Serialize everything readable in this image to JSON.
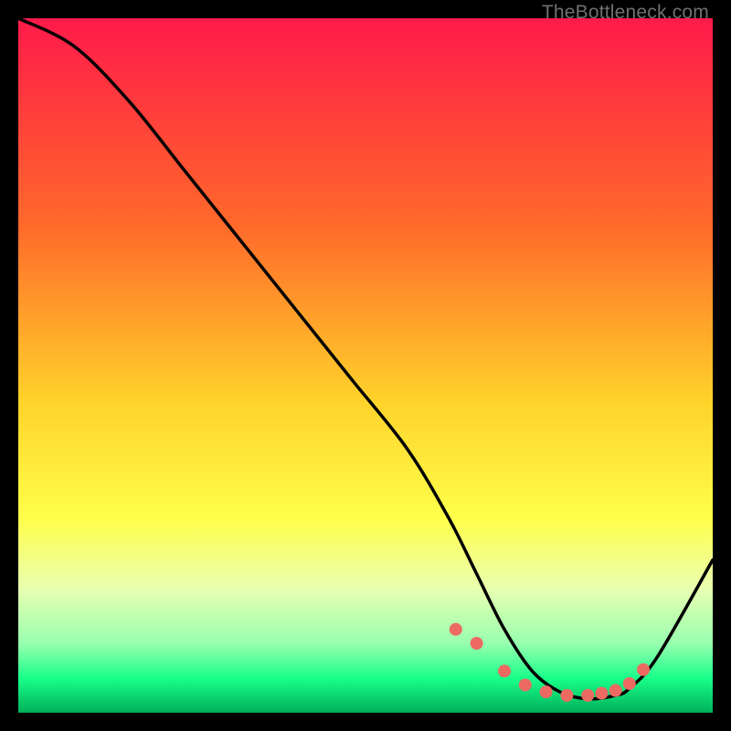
{
  "watermark": "TheBottleneck.com",
  "chart_data": {
    "type": "line",
    "title": "",
    "xlabel": "",
    "ylabel": "",
    "xlim": [
      0,
      100
    ],
    "ylim": [
      0,
      100
    ],
    "gradient_stops": [
      {
        "offset": 0,
        "color": "#ff1a4a"
      },
      {
        "offset": 30,
        "color": "#ff6a2a"
      },
      {
        "offset": 55,
        "color": "#ffd22a"
      },
      {
        "offset": 72,
        "color": "#ffff4a"
      },
      {
        "offset": 82,
        "color": "#eaffb0"
      },
      {
        "offset": 90,
        "color": "#98ffb0"
      },
      {
        "offset": 95,
        "color": "#1aff8a"
      },
      {
        "offset": 100,
        "color": "#00b05a"
      }
    ],
    "series": [
      {
        "name": "bottleneck-curve",
        "x": [
          0,
          8,
          16,
          24,
          32,
          40,
          48,
          56,
          62,
          66,
          70,
          74,
          78,
          82,
          86,
          88,
          92,
          100
        ],
        "y": [
          100,
          96,
          88,
          78,
          68,
          58,
          48,
          38,
          28,
          20,
          12,
          6,
          3,
          2,
          2.5,
          3.5,
          8,
          22
        ]
      }
    ],
    "points": {
      "name": "bottleneck-dots",
      "x": [
        63,
        66,
        70,
        73,
        76,
        79,
        82,
        84,
        86,
        88,
        90
      ],
      "y": [
        12,
        10,
        6,
        4,
        3,
        2.5,
        2.5,
        2.8,
        3.2,
        4.2,
        6.2
      ],
      "color": "#ec6a62",
      "radius": 7
    }
  }
}
